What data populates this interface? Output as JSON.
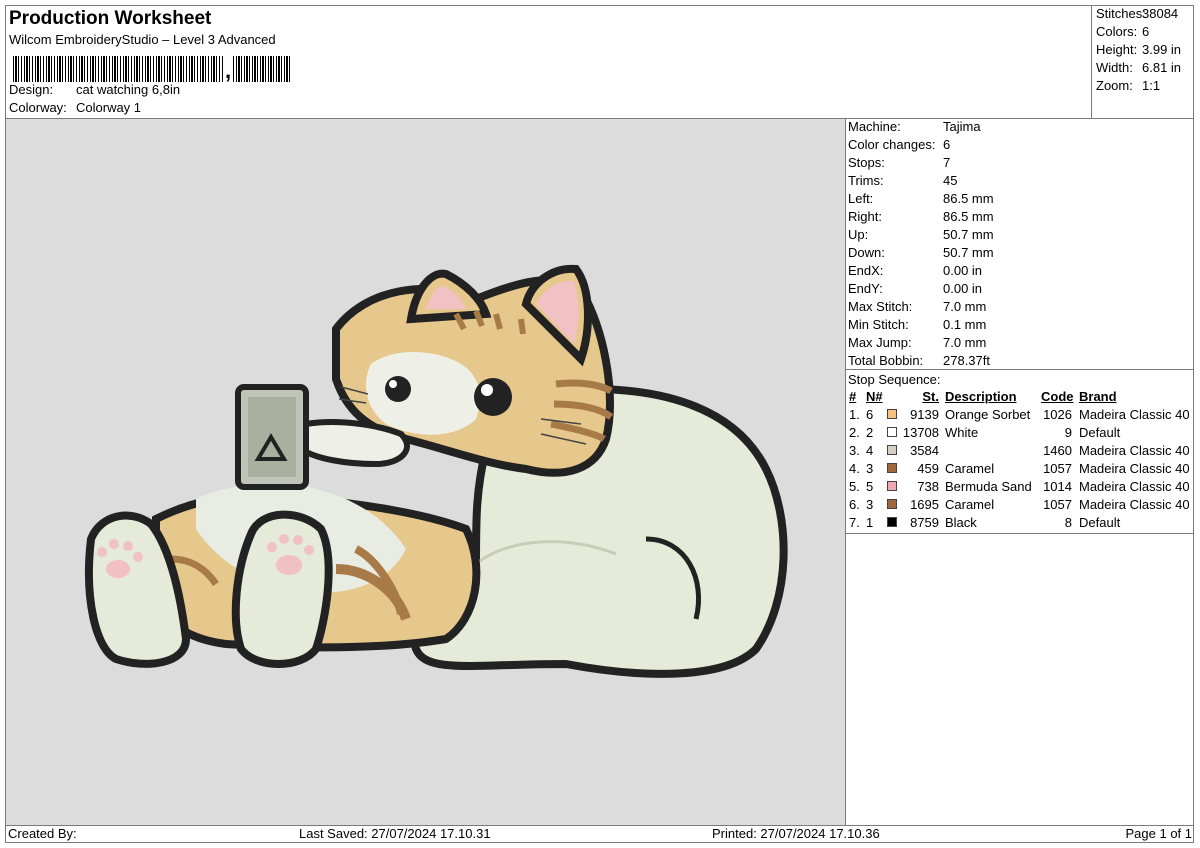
{
  "header": {
    "title": "Production Worksheet",
    "software": "Wilcom EmbroideryStudio – Level 3 Advanced",
    "design_label": "Design:",
    "design_value": "cat watching 6,8in",
    "colorway_label": "Colorway:",
    "colorway_value": "Colorway 1"
  },
  "summary": {
    "stitches_label": "Stitches:",
    "stitches": "38084",
    "colors_label": "Colors:",
    "colors": "6",
    "height_label": "Height:",
    "height": "3.99 in",
    "width_label": "Width:",
    "width": "6.81 in",
    "zoom_label": "Zoom:",
    "zoom": "1:1"
  },
  "machine_info": [
    {
      "label": "Machine:",
      "value": "Tajima"
    },
    {
      "label": "Color changes:",
      "value": "6"
    },
    {
      "label": "Stops:",
      "value": "7"
    },
    {
      "label": "Trims:",
      "value": "45"
    },
    {
      "label": "Left:",
      "value": "86.5 mm"
    },
    {
      "label": "Right:",
      "value": "86.5 mm"
    },
    {
      "label": "Up:",
      "value": "50.7 mm"
    },
    {
      "label": "Down:",
      "value": "50.7 mm"
    },
    {
      "label": "EndX:",
      "value": "0.00 in"
    },
    {
      "label": "EndY:",
      "value": "0.00 in"
    },
    {
      "label": "Max Stitch:",
      "value": "7.0 mm"
    },
    {
      "label": "Min Stitch:",
      "value": "0.1 mm"
    },
    {
      "label": "Max Jump:",
      "value": "7.0 mm"
    },
    {
      "label": "Total Bobbin:",
      "value": "278.37ft"
    }
  ],
  "stop_sequence": {
    "title": "Stop Sequence:",
    "headers": {
      "num": "#",
      "n": "N#",
      "st": "St.",
      "desc": "Description",
      "code": "Code",
      "brand": "Brand"
    },
    "rows": [
      {
        "num": "1.",
        "n": "6",
        "color": "#f6c183",
        "st": "9139",
        "desc": "Orange Sorbet",
        "code": "1026",
        "brand": "Madeira Classic 40"
      },
      {
        "num": "2.",
        "n": "2",
        "color": "#ffffff",
        "st": "13708",
        "desc": "White",
        "code": "9",
        "brand": "Default"
      },
      {
        "num": "3.",
        "n": "4",
        "color": "#d4cfc2",
        "st": "3584",
        "desc": "",
        "code": "1460",
        "brand": "Madeira Classic 40"
      },
      {
        "num": "4.",
        "n": "3",
        "color": "#a0663c",
        "st": "459",
        "desc": "Caramel",
        "code": "1057",
        "brand": "Madeira Classic 40"
      },
      {
        "num": "5.",
        "n": "5",
        "color": "#efa7b1",
        "st": "738",
        "desc": "Bermuda Sand",
        "code": "1014",
        "brand": "Madeira Classic 40"
      },
      {
        "num": "6.",
        "n": "3",
        "color": "#a0663c",
        "st": "1695",
        "desc": "Caramel",
        "code": "1057",
        "brand": "Madeira Classic 40"
      },
      {
        "num": "7.",
        "n": "1",
        "color": "#000000",
        "st": "8759",
        "desc": "Black",
        "code": "8",
        "brand": "Default"
      }
    ]
  },
  "footer": {
    "created_by": "Created By:",
    "last_saved": "Last Saved: 27/07/2024 17.10.31",
    "printed": "Printed: 27/07/2024 17.10.36",
    "page": "Page 1 of 1"
  }
}
